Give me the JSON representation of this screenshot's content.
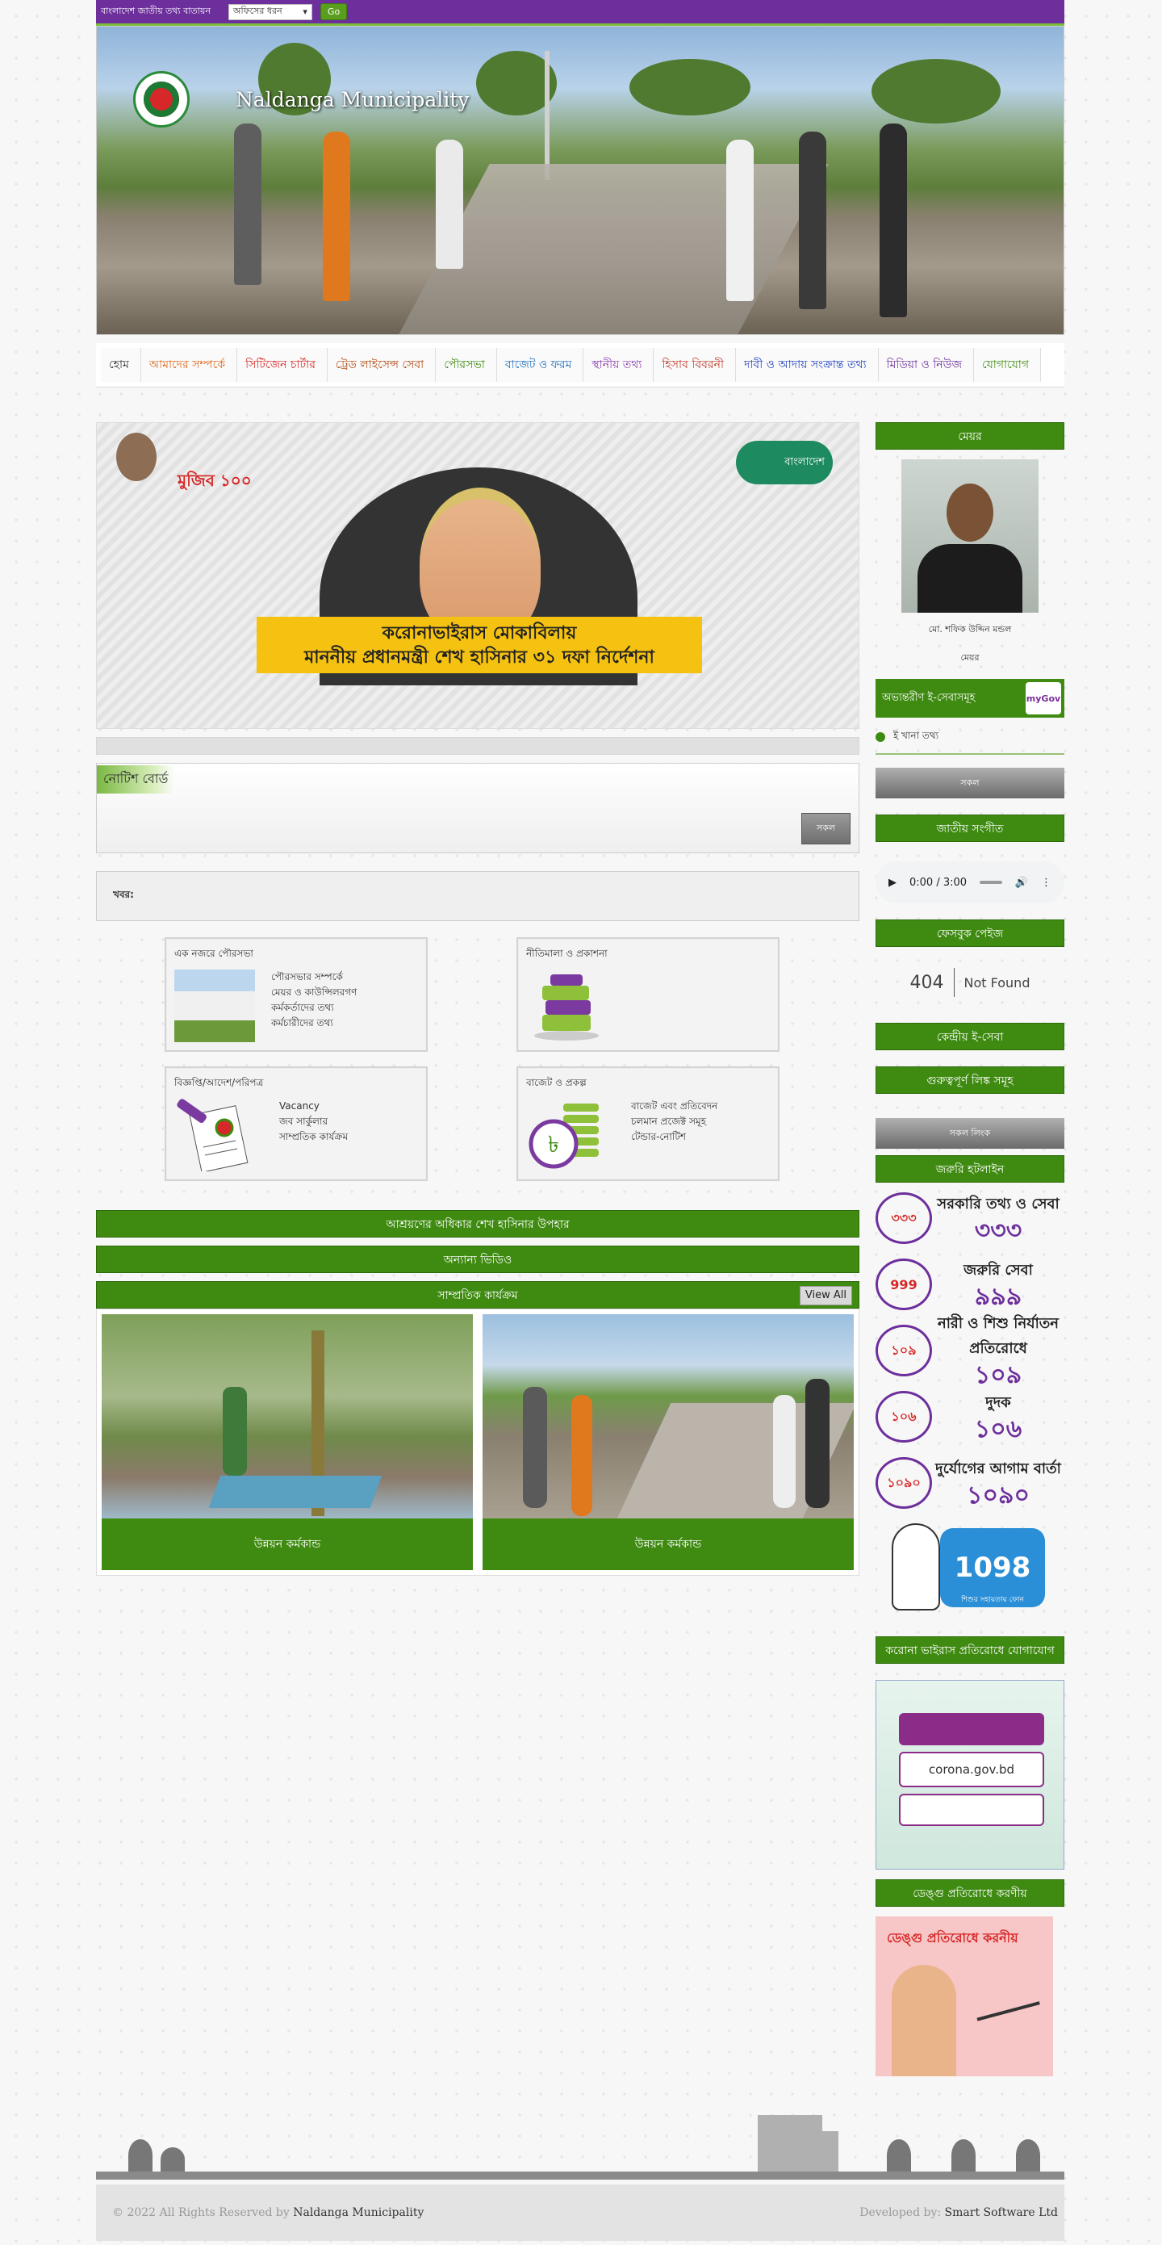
{
  "topbar": {
    "portal_label": "বাংলাদেশ জাতীয় তথ্য বাতায়ন",
    "office_select": "অফিসের ধরন",
    "go_label": "Go"
  },
  "banner": {
    "title": "Naldanga Municipality"
  },
  "nav": [
    {
      "label": "হোম",
      "color": "#333333"
    },
    {
      "label": "আমাদের সম্পর্কে",
      "color": "#e0681c"
    },
    {
      "label": "সিটিজেন চার্টার",
      "color": "#d62828"
    },
    {
      "label": "ট্রেড লাইসেন্স সেবা",
      "color": "#b04a12"
    },
    {
      "label": "পৌরসভা",
      "color": "#3f8b12"
    },
    {
      "label": "বাজেট ও ফরম",
      "color": "#1f6fbf"
    },
    {
      "label": "স্থানীয় তথ্য",
      "color": "#8b3ab0"
    },
    {
      "label": "হিসাব বিবরনী",
      "color": "#c0392b"
    },
    {
      "label": "দাবী ও আদায় সংক্রান্ত তথ্য",
      "color": "#1f3fbf"
    },
    {
      "label": "মিডিয়া ও নিউজ",
      "color": "#6d2f9c"
    },
    {
      "label": "যোগাযোগ",
      "color": "#3f8b12"
    }
  ],
  "slider": {
    "caption_line1": "করোনাভাইরাস মোকাবিলায়",
    "caption_line2": "মাননীয় প্রধানমন্ত্রী শেখ হাসিনার ৩১ দফা নির্দেশনা",
    "mujib_badge": "মুজিব ১০০",
    "campaign_logo": "বাংলাদেশ"
  },
  "notice": {
    "title": "নোটিশ বোর্ড",
    "all_label": "সকল"
  },
  "news": {
    "label": "খবর:"
  },
  "boxes": [
    {
      "title": "এক নজরে পৌরসভা",
      "links": [
        "পৌরসভার সম্পর্কে",
        "মেয়র ও কাউন্সিলরগণ",
        "কর্মকর্তাদের তথ্য",
        "কর্মচারীদের তথ্য"
      ]
    },
    {
      "title": "নীতিমালা ও প্রকাশনা",
      "links": []
    },
    {
      "title": "বিজ্ঞপ্তি/আদেশ/পরিপত্র",
      "links": [
        "Vacancy",
        "জব সার্কুলার",
        "সাম্প্রতিক কার্যক্রম"
      ]
    },
    {
      "title": "বাজেট ও প্রকল্প",
      "links": [
        "বাজেট এবং প্রতিবেদন",
        "চলমান প্রজেক্ট সমূহ",
        "টেন্ডার-নোটিশ"
      ]
    }
  ],
  "sections": {
    "ashrayan": "আশ্রয়ণের অধিকার শেখ হাসিনার উপহার",
    "videos": "অন্যান্য ভিডিও",
    "recent": "সাম্প্রতিক কার্যক্রম",
    "view_all": "View All"
  },
  "gallery": [
    {
      "caption": "উন্নয়ন কর্মকান্ড"
    },
    {
      "caption": "উন্নয়ন কর্মকান্ড"
    }
  ],
  "sidebar": {
    "mayor_head": "মেয়র",
    "mayor_name": "মো. শফিক উদ্দিন মন্ডল",
    "mayor_title": "মেয়র",
    "eservice_head": "অভ্যন্তরীণ ই-সেবাসমূহ",
    "mygov": "myGov",
    "eservice_item": "ই খানা তথ্য",
    "all_label": "সকল",
    "anthem_head": "জাতীয় সংগীত",
    "audio_time": "0:00 / 3:00",
    "facebook_head": "ফেসবুক পেইজ",
    "nf_code": "404",
    "nf_msg": "Not Found",
    "central_eservice": "কেন্দ্রীয় ই-সেবা",
    "important_links": "গুরুত্বপূর্ণ লিঙ্ক সমূহ",
    "all_links": "সকল লিংক",
    "hotline_head": "জরুরি হটলাইন",
    "hotlines": [
      {
        "icon": "৩৩৩",
        "t1": "সরকারি তথ্য ও সেবা",
        "t2": "৩৩৩"
      },
      {
        "icon": "999",
        "t1": "জরুরি সেবা",
        "t2": "৯৯৯"
      },
      {
        "icon": "১০৯",
        "t1": "নারী ও শিশু নির্যাতন প্রতিরোধে",
        "t2": "১০৯"
      },
      {
        "icon": "১০৬",
        "t1": "দুদক",
        "t2": "১০৬"
      },
      {
        "icon": "১০৯০",
        "t1": "দুর্যোগের আগাম বার্তা",
        "t2": "১০৯০"
      }
    ],
    "child_line": "1098",
    "child_line_sub": "শিশুর সহায়তায় ফোন",
    "corona_head": "করোনা ভাইরাস প্রতিরোধে যোগাযোগ",
    "corona_site": "corona.gov.bd",
    "dengue_head": "ডেঙ্গু প্রতিরোধে করণীয়",
    "dengue_text": "ডেঙ্গু প্রতিরোধে করনীয়"
  },
  "footer": {
    "copyright": "© 2022 All Rights Reserved by",
    "owner": "Naldanga Municipality",
    "dev_label": "Developed by:",
    "developer": "Smart Software Ltd"
  }
}
